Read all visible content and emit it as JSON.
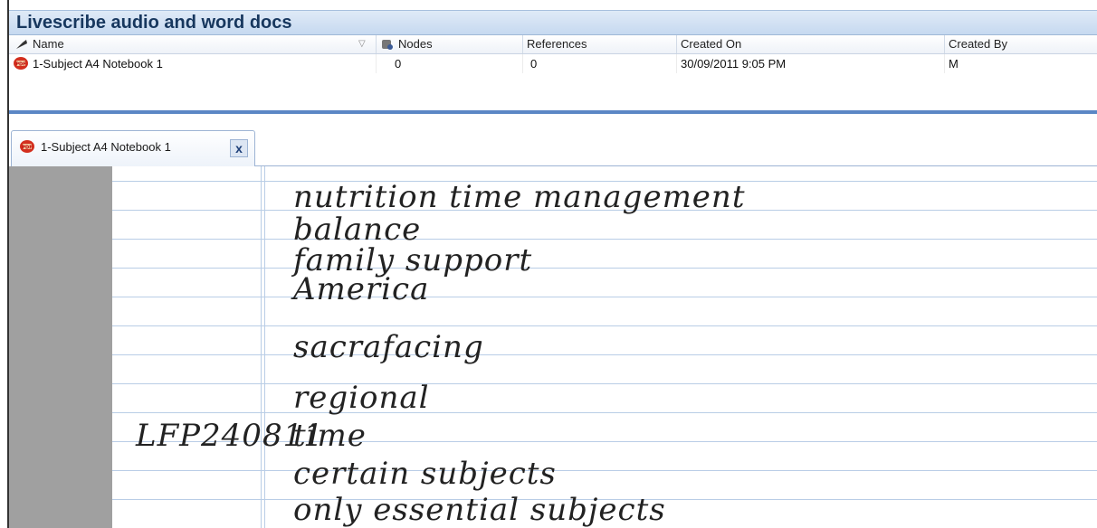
{
  "panel": {
    "title": "Livescribe audio and word docs"
  },
  "list": {
    "columns": {
      "name": "Name",
      "nodes": "Nodes",
      "references": "References",
      "created_on": "Created On",
      "created_by": "Created By"
    },
    "rows": [
      {
        "name": "1-Subject A4 Notebook 1",
        "nodes": "0",
        "references": "0",
        "created_on": "30/09/2011 9:05 PM",
        "created_by": "M"
      }
    ]
  },
  "tab": {
    "label": "1-Subject A4 Notebook 1",
    "close_glyph": "x"
  },
  "notebook": {
    "handwriting_lines": [
      "nutrition  time management",
      "balance",
      "family support",
      "America",
      "sacrafacing",
      "regional",
      "time",
      "certain subjects",
      "only essential subjects"
    ],
    "margin_note": "LFP240811"
  },
  "colors": {
    "title_text": "#17375e",
    "title_bar": "#c6d9f0",
    "accent_blue": "#5b87c5",
    "rule_lines": "#b9cde6"
  }
}
